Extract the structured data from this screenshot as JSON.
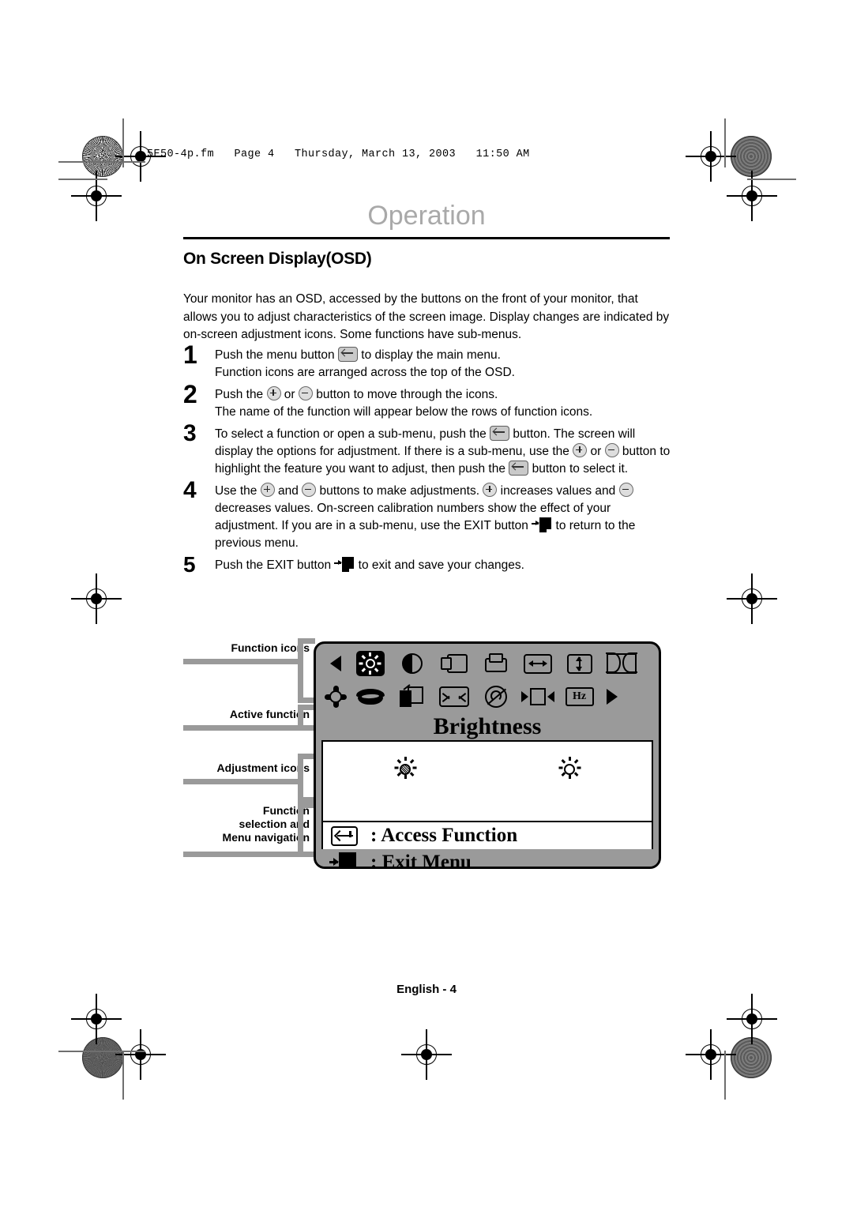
{
  "fm_header": "5E50-4p.fm   Page 4   Thursday, March 13, 2003   11:50 AM",
  "page_title": "Operation",
  "section_heading": "On Screen Display(OSD)",
  "intro": "Your monitor has an OSD, accessed by the buttons on the front of your monitor, that allows you to adjust characteristics of the screen image. Display changes are indicated by on-screen adjustment icons. Some functions have sub-menus.",
  "steps": [
    {
      "number": "1",
      "parts": [
        {
          "text": "Push the menu button "
        },
        {
          "icon": "menu-button-icon"
        },
        {
          "text": " to display the main menu."
        },
        {
          "break": true
        },
        {
          "text": "Function icons are arranged across the top of the OSD."
        }
      ]
    },
    {
      "number": "2",
      "parts": [
        {
          "text": "Push the "
        },
        {
          "icon": "plus-button-icon"
        },
        {
          "text": " or "
        },
        {
          "icon": "minus-button-icon"
        },
        {
          "text": " button to move through the icons."
        },
        {
          "break": true
        },
        {
          "text": "The name of the function will appear below the rows of function icons."
        }
      ]
    },
    {
      "number": "3",
      "parts": [
        {
          "text": "To select a function or open a sub-menu, push the "
        },
        {
          "icon": "menu-button-icon"
        },
        {
          "text": " button. The screen will display the options for adjustment. If there is a sub-menu, use the "
        },
        {
          "icon": "plus-button-icon"
        },
        {
          "text": " or "
        },
        {
          "icon": "minus-button-icon"
        },
        {
          "text": " button to highlight the feature you want to adjust, then push the "
        },
        {
          "icon": "menu-button-icon"
        },
        {
          "text": " button to select it."
        }
      ]
    },
    {
      "number": "4",
      "parts": [
        {
          "text": "Use the "
        },
        {
          "icon": "plus-button-icon"
        },
        {
          "text": " and "
        },
        {
          "icon": "minus-button-icon"
        },
        {
          "text": " buttons to make adjustments. "
        },
        {
          "icon": "plus-button-icon"
        },
        {
          "text": " increases values and "
        },
        {
          "icon": "minus-button-icon"
        },
        {
          "text": " decreases values. On-screen calibration numbers show the effect of your adjustment. If you are in a sub-menu, use the EXIT button "
        },
        {
          "icon": "exit-button-icon"
        },
        {
          "text": " to return to the previous menu."
        }
      ]
    },
    {
      "number": "5",
      "parts": [
        {
          "text": "Push the EXIT button "
        },
        {
          "icon": "exit-button-icon"
        },
        {
          "text": " to exit and save your changes."
        }
      ]
    }
  ],
  "diagram": {
    "callouts": [
      {
        "label": "Function icons"
      },
      {
        "label": "Active function"
      },
      {
        "label": "Adjustment icons"
      },
      {
        "label": "Function\nselection and\nMenu navigation"
      }
    ],
    "osd": {
      "active_function_name": "Brightness",
      "icon_row_1": [
        "prev-arrow-icon",
        "brightness-icon",
        "contrast-icon",
        "h-position-icon",
        "v-position-icon",
        "h-size-icon",
        "v-size-icon",
        "pincushion-icon"
      ],
      "icon_row_2": [
        "rotation-icon",
        "trapezoid-icon",
        "color-layers-icon",
        "zoom-icon",
        "degauss-icon",
        "screen-position-icon",
        "hz-frequency-icon",
        "next-arrow-icon"
      ],
      "hz_label": "Hz",
      "adjustment_icons": [
        "brightness-dark-icon",
        "brightness-light-icon"
      ],
      "legend": [
        {
          "icon": "enter-key-icon",
          "text": ": Access Function"
        },
        {
          "icon": "exit-door-icon",
          "text": ": Exit Menu"
        }
      ]
    }
  },
  "footer": "English - 4",
  "colors": {
    "osd_gray": "#9a9a9a",
    "title_gray": "#a9a9a9",
    "callout_bar": "#9a9a9a"
  }
}
